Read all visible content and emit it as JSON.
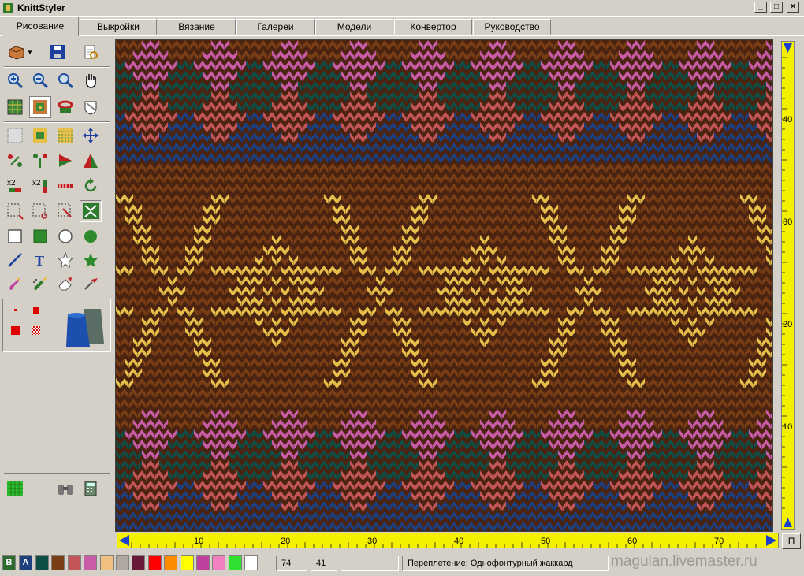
{
  "window": {
    "title": "KnittStyler",
    "controls": [
      "_",
      "□",
      "×"
    ]
  },
  "tabs": [
    {
      "label": "Рисование",
      "active": true
    },
    {
      "label": "Выкройки"
    },
    {
      "label": "Вязание"
    },
    {
      "label": "Галереи"
    },
    {
      "label": "Модели"
    },
    {
      "label": "Конвертор"
    },
    {
      "label": "Руководство"
    }
  ],
  "tools": [
    "open-icon",
    "save-icon",
    "print-preview-icon",
    "zoom-in-icon",
    "zoom-out-icon",
    "zoom-fit-icon",
    "hand-icon",
    "grid-icon",
    "pattern-icon",
    "rotate-icon",
    "shield-icon",
    "select-grid-icon",
    "fill-icon",
    "texture-icon",
    "move-icon",
    "flip-horizontal-icon",
    "flip-vertical-icon",
    "triangle-right-icon",
    "triangle-up-icon",
    "double-width-icon",
    "double-height-icon",
    "stitch-line-icon",
    "refresh-icon",
    "select-rect-icon",
    "cut-icon",
    "paste-icon",
    "mirror-icon",
    "rect-icon",
    "filled-rect-icon",
    "ellipse-icon",
    "filled-ellipse-icon",
    "line-icon",
    "text-icon",
    "star-icon",
    "filled-star-icon",
    "brush-icon",
    "spray-icon",
    "eraser-icon",
    "eyedropper-icon",
    "grid-fill-icon",
    "binoculars-icon",
    "calculator-icon"
  ],
  "colors": {
    "brown": "#7a3e16",
    "pink": "#c85ca6",
    "teal": "#0f4d47",
    "coral": "#c45559",
    "navy": "#1d3f7e",
    "gold": "#e6be4a"
  },
  "rulers": {
    "vertical": [
      "40",
      "30",
      "20",
      "10"
    ],
    "horizontal": [
      "10",
      "20",
      "30",
      "40",
      "50",
      "60",
      "70"
    ],
    "corner_button": "П"
  },
  "status": {
    "palette_labels": [
      "B",
      "A"
    ],
    "palette": [
      "#0f4d47",
      "#7a3e16",
      "#c45559",
      "#c85ca6",
      "#f0c080",
      "#b0a8a0",
      "#6a1a38",
      "#ff0000",
      "#ff8c00",
      "#ffff00",
      "#c040a0",
      "#f080c0",
      "#30e030",
      "#ffffff"
    ],
    "x_value": "74",
    "y_value": "41",
    "mode": "Переплетение: Однофонтурный жаккард"
  },
  "watermark": "magulan.livemaster.ru"
}
